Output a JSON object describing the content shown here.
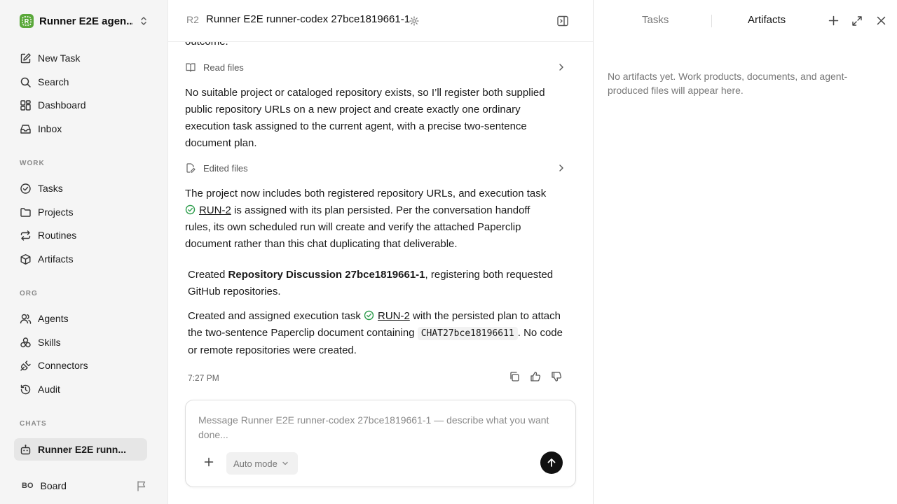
{
  "sidebar": {
    "workspace_name": "Runner E2E agen...",
    "primary_nav": [
      {
        "label": "New Task",
        "icon": "new-task-icon"
      },
      {
        "label": "Search",
        "icon": "search-icon"
      },
      {
        "label": "Dashboard",
        "icon": "dashboard-icon"
      },
      {
        "label": "Inbox",
        "icon": "inbox-icon"
      }
    ],
    "work_label": "WORK",
    "work_nav": [
      {
        "label": "Tasks",
        "icon": "check-circle-icon"
      },
      {
        "label": "Projects",
        "icon": "folder-icon"
      },
      {
        "label": "Routines",
        "icon": "repeat-icon"
      },
      {
        "label": "Artifacts",
        "icon": "box-icon"
      }
    ],
    "org_label": "ORG",
    "org_nav": [
      {
        "label": "Agents",
        "icon": "users-icon"
      },
      {
        "label": "Skills",
        "icon": "skills-icon"
      },
      {
        "label": "Connectors",
        "icon": "plug-icon"
      },
      {
        "label": "Audit",
        "icon": "history-icon"
      }
    ],
    "chats_label": "CHATS",
    "chats": [
      {
        "label": "Runner E2E runn...",
        "icon": "bot-icon",
        "active": true
      }
    ],
    "board": {
      "initials": "BO",
      "label": "Board"
    }
  },
  "chat": {
    "agent_initials": "R2",
    "title": "Runner E2E runner-codex 27bce1819661-1",
    "clipped_text": "outcome.",
    "tool_read": "Read files",
    "para1": "No suitable project or cataloged repository exists, so I’ll register both supplied public repository URLs on a new project and create exactly one ordinary execution task assigned to the current agent, with a precise two-sentence document plan.",
    "tool_edit": "Edited files",
    "para2_before": "The project now includes both registered repository URLs, and execution task ",
    "para2_link": "RUN-2",
    "para2_after": " is assigned with its plan persisted. Per the conversation handoff rules, its own scheduled run will create and verify the attached Paperclip document rather than this chat duplicating that deliverable.",
    "summary1_before": "Created ",
    "summary1_bold": "Repository Discussion 27bce1819661-1",
    "summary1_after": ", registering both requested GitHub repositories.",
    "summary2_before": "Created and assigned execution task ",
    "summary2_link": "RUN-2",
    "summary2_mid": " with the persisted plan to attach the two-sentence Paperclip document containing ",
    "summary2_code": "CHAT27bce18196611",
    "summary2_after": ". No code or remote repositories were created.",
    "time": "7:27 PM",
    "composer_placeholder": "Message Runner E2E runner-codex 27bce1819661-1 — describe what you want done...",
    "mode_label": "Auto mode"
  },
  "panel": {
    "tab_tasks": "Tasks",
    "tab_artifacts": "Artifacts",
    "active_tab": "Artifacts",
    "empty_text": "No artifacts yet. Work products, documents, and agent-produced files will appear here."
  },
  "colors": {
    "accent_green": "#5aa83a",
    "status_green": "#2e9d4c",
    "send_button": "#111111",
    "sidebar_bg": "#f5f5f5"
  }
}
